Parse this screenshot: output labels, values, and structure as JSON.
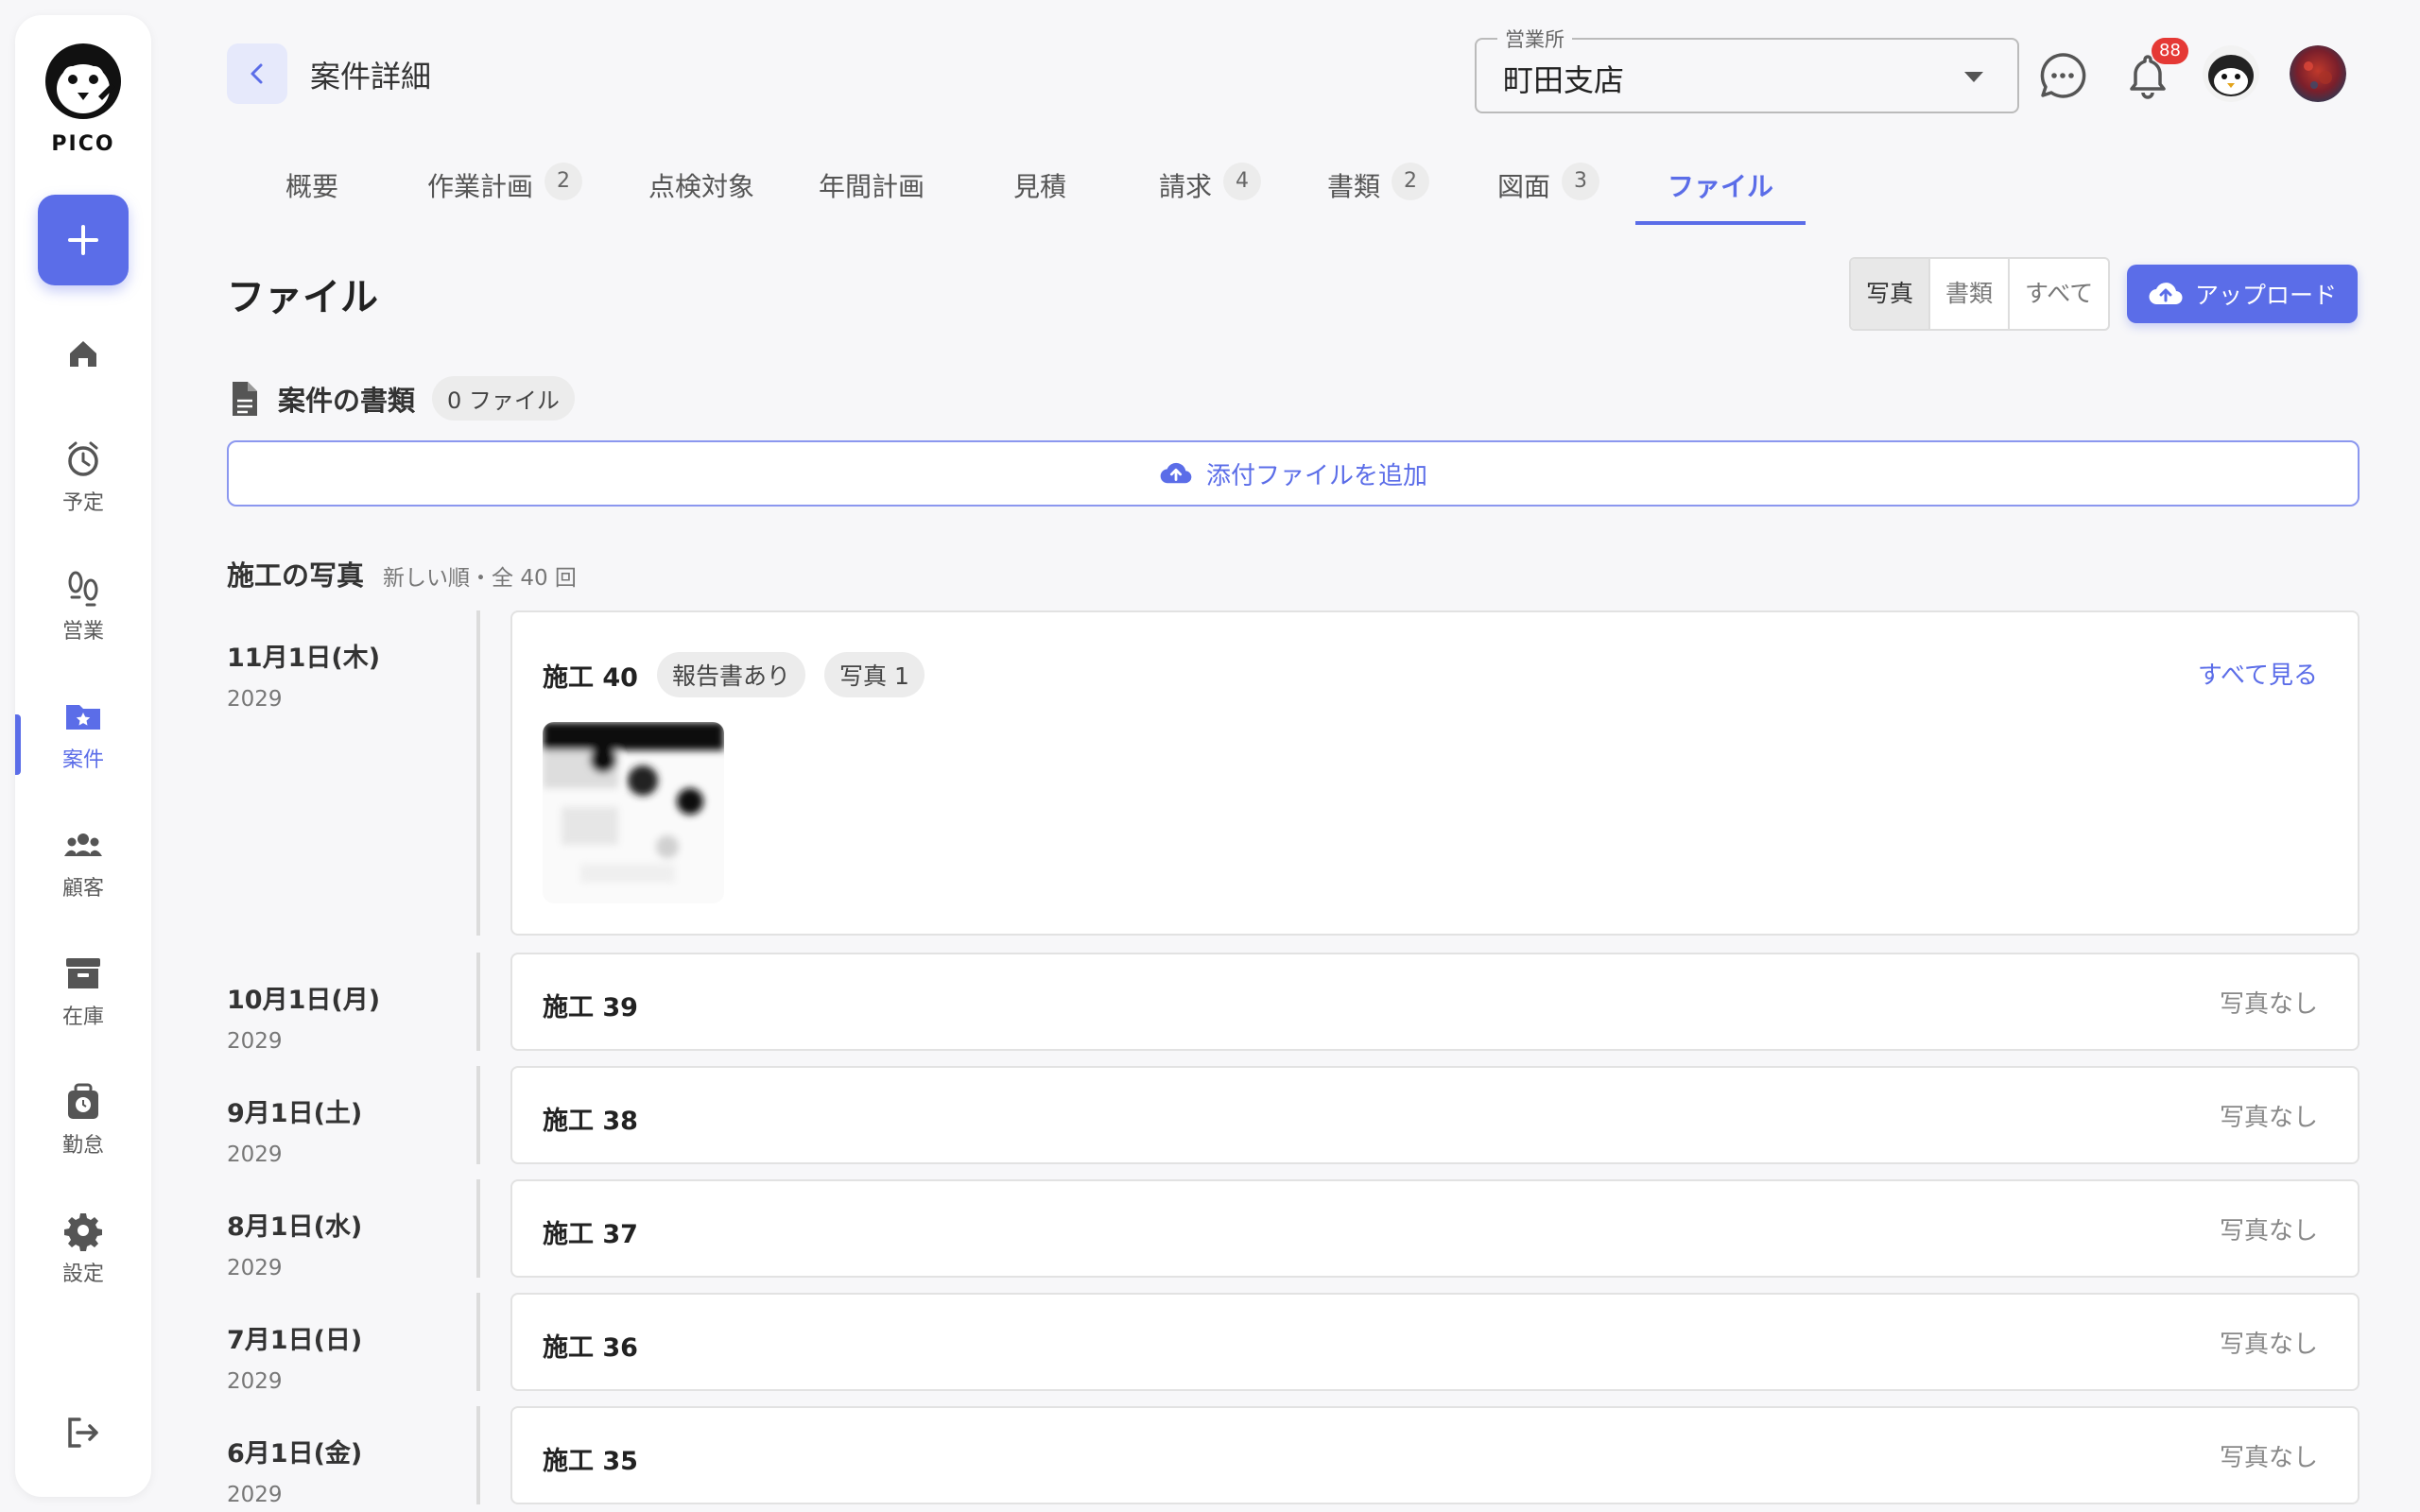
{
  "sidebar": {
    "logo_text": "PICO",
    "items": [
      {
        "label": ""
      },
      {
        "label": "予定"
      },
      {
        "label": "営業"
      },
      {
        "label": "案件"
      },
      {
        "label": "顧客"
      },
      {
        "label": "在庫"
      },
      {
        "label": "勤怠"
      },
      {
        "label": "設定"
      }
    ],
    "active_index": 3
  },
  "header": {
    "title": "案件詳細",
    "branch_label": "営業所",
    "branch_value": "町田支店",
    "notification_count": "88"
  },
  "tabs": [
    {
      "label": "概要",
      "count": ""
    },
    {
      "label": "作業計画",
      "count": "2"
    },
    {
      "label": "点検対象",
      "count": ""
    },
    {
      "label": "年間計画",
      "count": ""
    },
    {
      "label": "見積",
      "count": ""
    },
    {
      "label": "請求",
      "count": "4"
    },
    {
      "label": "書類",
      "count": "2"
    },
    {
      "label": "図面",
      "count": "3"
    },
    {
      "label": "ファイル",
      "count": ""
    }
  ],
  "active_tab": 8,
  "main": {
    "title": "ファイル",
    "filter": [
      "写真",
      "書類",
      "すべて"
    ],
    "filter_selected": "写真",
    "upload_label": "アップロード",
    "docs_title": "案件の書類",
    "docs_count": "0 ファイル",
    "add_attachment_label": "添付ファイルを追加",
    "photos_title": "施工の写真",
    "photos_sub": "新しい順・全 40 回"
  },
  "timeline": [
    {
      "date": "11月1日(木)",
      "year": "2029",
      "title": "施工 40",
      "chips": [
        "報告書あり",
        "写真 1"
      ],
      "right": "すべて見る"
    },
    {
      "date": "10月1日(月)",
      "year": "2029",
      "title": "施工 39",
      "right": "写真なし"
    },
    {
      "date": "9月1日(土)",
      "year": "2029",
      "title": "施工 38",
      "right": "写真なし"
    },
    {
      "date": "8月1日(水)",
      "year": "2029",
      "title": "施工 37",
      "right": "写真なし"
    },
    {
      "date": "7月1日(日)",
      "year": "2029",
      "title": "施工 36",
      "right": "写真なし"
    },
    {
      "date": "6月1日(金)",
      "year": "2029",
      "title": "施工 35",
      "right": "写真なし"
    }
  ],
  "colors": {
    "accent": "#5b6de8",
    "badge": "#e53935"
  }
}
